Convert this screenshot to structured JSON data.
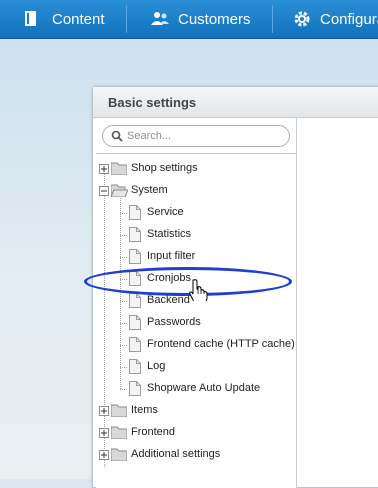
{
  "nav": {
    "items": [
      {
        "label": "Content",
        "icon": "document-icon"
      },
      {
        "label": "Customers",
        "icon": "users-icon"
      },
      {
        "label": "Configura",
        "icon": "gear-icon"
      }
    ]
  },
  "window": {
    "title": "Basic settings"
  },
  "search": {
    "placeholder": "Search..."
  },
  "tree": {
    "shop_settings": "Shop settings",
    "system": "System",
    "system_children": [
      "Service",
      "Statistics",
      "Input filter",
      "Cronjobs",
      "Backend",
      "Passwords",
      "Frontend cache (HTTP cache)",
      "Log",
      "Shopware Auto Update"
    ],
    "items": "Items",
    "frontend": "Frontend",
    "additional_settings": "Additional settings"
  },
  "colors": {
    "nav_bg": "#1a7cc8",
    "highlight": "#1f3fd1"
  }
}
